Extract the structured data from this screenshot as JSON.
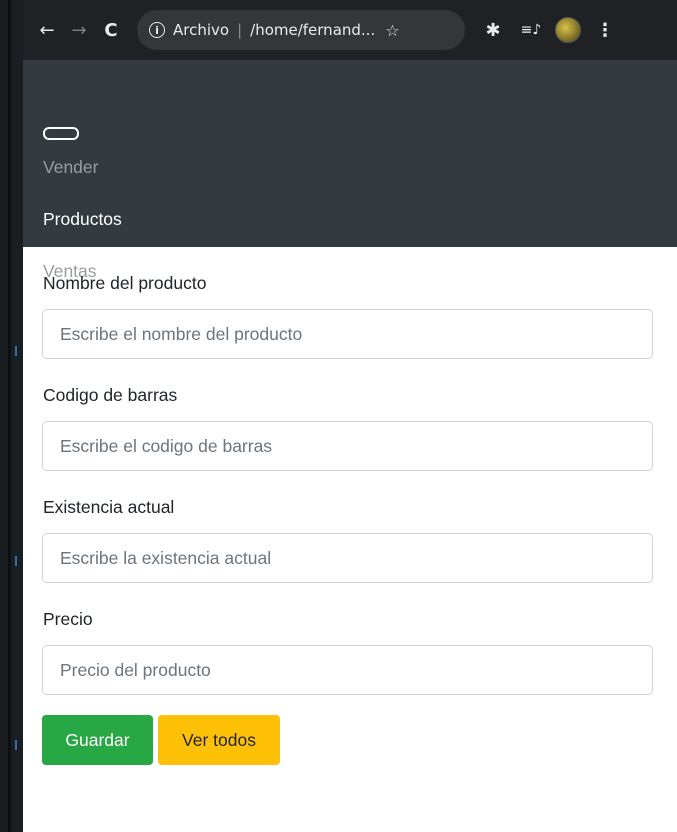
{
  "browser": {
    "back_icon": "←",
    "forward_icon": "→",
    "reload_icon": "C",
    "info_icon": "i",
    "scheme_label": "Archivo",
    "separator": "|",
    "url": "/home/fernand...",
    "star_icon": "☆",
    "extensions_icon": "✱",
    "media_icon": "≡♪",
    "menu_icon": "⋮"
  },
  "navbar": {
    "items": [
      {
        "label": "Vender",
        "active": false
      },
      {
        "label": "Productos",
        "active": true
      },
      {
        "label": "Ventas",
        "active": false
      }
    ]
  },
  "form": {
    "fields": [
      {
        "label": "Nombre del producto",
        "placeholder": "Escribe el nombre del producto",
        "value": ""
      },
      {
        "label": "Codigo de barras",
        "placeholder": "Escribe el codigo de barras",
        "value": ""
      },
      {
        "label": "Existencia actual",
        "placeholder": "Escribe la existencia actual",
        "value": ""
      },
      {
        "label": "Precio",
        "placeholder": "Precio del producto",
        "value": ""
      }
    ],
    "save_label": "Guardar",
    "view_all_label": "Ver todos"
  },
  "colors": {
    "navbar_bg": "#343a40",
    "success": "#28a745",
    "warning": "#ffc107",
    "browser_bg": "#202124"
  }
}
